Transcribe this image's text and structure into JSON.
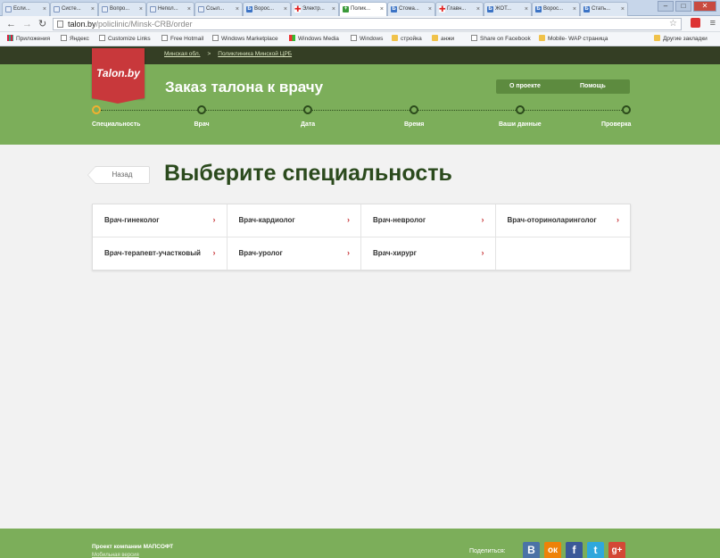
{
  "browser": {
    "tabs": [
      {
        "label": "Если...",
        "favicon": "doc-icon",
        "active": false
      },
      {
        "label": "Систе...",
        "favicon": "doc-icon",
        "active": false
      },
      {
        "label": "Вопро...",
        "favicon": "doc-icon",
        "active": false
      },
      {
        "label": "Непол...",
        "favicon": "doc-icon",
        "active": false
      },
      {
        "label": "Ссыл...",
        "favicon": "doc-icon",
        "active": false
      },
      {
        "label": "Ворос...",
        "favicon": "b-icon",
        "active": false
      },
      {
        "label": "Электр...",
        "favicon": "red-cross-icon",
        "active": false
      },
      {
        "label": "Полик...",
        "favicon": "plus-icon",
        "active": true
      },
      {
        "label": "Стома...",
        "favicon": "b-icon",
        "active": false
      },
      {
        "label": "Главн...",
        "favicon": "red-cross-icon",
        "active": false
      },
      {
        "label": "ЖОТ...",
        "favicon": "b-icon",
        "active": false
      },
      {
        "label": "Ворос...",
        "favicon": "b-icon",
        "active": false
      },
      {
        "label": "Стать...",
        "favicon": "b-icon",
        "active": false
      }
    ],
    "url_host": "talon.by",
    "url_path": "/policlinic/Minsk-CRB/order",
    "bookmarks": [
      {
        "label": "Приложения",
        "icon": "grid-icon"
      },
      {
        "label": "Яндекс",
        "icon": "page-icon"
      },
      {
        "label": "Customize Links",
        "icon": "page-icon"
      },
      {
        "label": "Free Hotmail",
        "icon": "page-icon"
      },
      {
        "label": "Windows Marketplace",
        "icon": "page-icon"
      },
      {
        "label": "Windows Media",
        "icon": "windows-icon"
      },
      {
        "label": "Windows",
        "icon": "page-icon"
      },
      {
        "label": "стройка",
        "icon": "folder-icon"
      },
      {
        "label": "анжи",
        "icon": "folder-icon"
      },
      {
        "label": "Share on Facebook",
        "icon": "page-icon"
      },
      {
        "label": "Mobile- WAP страница",
        "icon": "folder-icon"
      },
      {
        "label": "Другие закладки",
        "icon": "folder-icon"
      }
    ]
  },
  "site": {
    "breadcrumb": [
      "Минская обл.",
      "Поликлиника Минской ЦРБ"
    ],
    "breadcrumb_sep": ">",
    "logo_text": "Talon.by",
    "header_title": "Заказ талона к врачу",
    "nav": {
      "about": "О проекте",
      "help": "Помощь"
    },
    "steps": [
      "Специальность",
      "Врач",
      "Дата",
      "Время",
      "Ваши данные",
      "Проверка"
    ],
    "current_step": 0
  },
  "main": {
    "back_label": "Назад",
    "title": "Выберите специальность",
    "arrow_glyph": "›",
    "specialties": [
      "Врач-гинеколог",
      "Врач-кардиолог",
      "Врач-невролог",
      "Врач-оториноларинголог",
      "Врач-терапевт-участковый",
      "Врач-уролог",
      "Врач-хирург",
      ""
    ]
  },
  "footer": {
    "company": "Проект компании МАПСОФТ",
    "mobile": "Мобильная версия",
    "share_label": "Поделиться:",
    "social": [
      {
        "glyph": "В",
        "name": "vk-icon",
        "color": "#4b73a6"
      },
      {
        "glyph": "ок",
        "name": "odnoklassniki-icon",
        "color": "#ee8208"
      },
      {
        "glyph": "f",
        "name": "facebook-icon",
        "color": "#3b5998"
      },
      {
        "glyph": "t",
        "name": "twitter-icon",
        "color": "#2fa8dc"
      },
      {
        "glyph": "g+",
        "name": "google-plus-icon",
        "color": "#d34836"
      }
    ]
  },
  "colors": {
    "header_green": "#7cae5a",
    "dark_bar": "#343e24",
    "title_green": "#2b4a1d",
    "logo_red": "#c8383b",
    "step_current": "#f0b030"
  }
}
